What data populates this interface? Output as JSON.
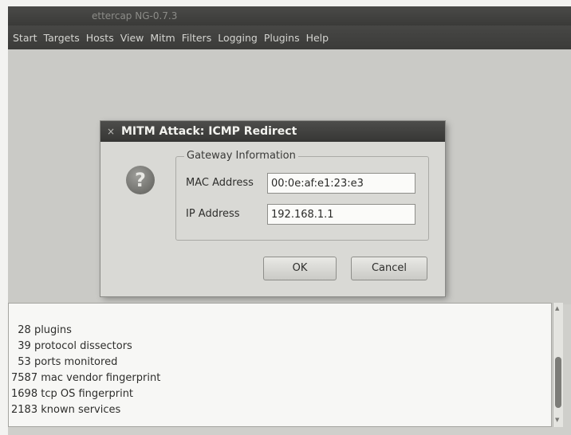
{
  "window": {
    "title": "ettercap NG-0.7.3"
  },
  "menubar": {
    "items": [
      {
        "label": "Start"
      },
      {
        "label": "Targets"
      },
      {
        "label": "Hosts"
      },
      {
        "label": "View"
      },
      {
        "label": "Mitm"
      },
      {
        "label": "Filters"
      },
      {
        "label": "Logging"
      },
      {
        "label": "Plugins"
      },
      {
        "label": "Help"
      }
    ]
  },
  "dialog": {
    "close_glyph": "×",
    "title": "MITM Attack: ICMP Redirect",
    "icon": "question-icon",
    "icon_glyph": "?",
    "group_label": "Gateway Information",
    "mac_label": "MAC Address",
    "mac_value": "00:0e:af:e1:23:e3",
    "ip_label": "IP Address",
    "ip_value": "192.168.1.1",
    "ok_label": "OK",
    "cancel_label": "Cancel"
  },
  "log": {
    "lines": [
      "  28 plugins",
      "  39 protocol dissectors",
      "  53 ports monitored",
      "7587 mac vendor fingerprint",
      "1698 tcp OS fingerprint",
      "2183 known services"
    ]
  },
  "scrollbar": {
    "up_arrow": "▲",
    "down_arrow": "▼"
  }
}
